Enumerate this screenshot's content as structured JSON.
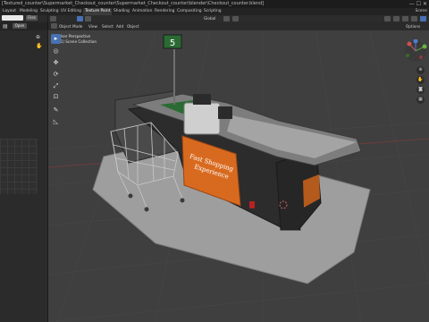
{
  "window": {
    "title": "[Textured_counter\\Supermarket_Checkout_counter\\Supermarket_Checkout_counter\\blender\\Checkout_counter.blend]",
    "scene_label": "Scene"
  },
  "workspace_tabs": [
    {
      "label": "Layout",
      "active": false
    },
    {
      "label": "Modeling",
      "active": false
    },
    {
      "label": "Sculpting",
      "active": false
    },
    {
      "label": "UV Editing",
      "active": false
    },
    {
      "label": "Texture Paint",
      "active": true
    },
    {
      "label": "Shading",
      "active": false
    },
    {
      "label": "Animation",
      "active": false
    },
    {
      "label": "Rendering",
      "active": false
    },
    {
      "label": "Compositing",
      "active": false
    },
    {
      "label": "Scripting",
      "active": false
    }
  ],
  "left_panel": {
    "files_label": "Files",
    "open_label": "Open"
  },
  "viewport_header": {
    "global_label": "Global",
    "mode_label": "Object Mode",
    "menus": [
      "View",
      "Select",
      "Add",
      "Object"
    ],
    "options_label": "Options"
  },
  "viewport_info": {
    "line1": "User Perspective",
    "line2": "(1) Scene Collection"
  },
  "scene": {
    "sign_text_line1": "Fast Shopping",
    "sign_text_line2": "Experience",
    "lane_number": "5",
    "colors": {
      "floor_mat": "#9e9e9e",
      "counter_body": "#2a2a2a",
      "counter_top": "#8a8a8a",
      "sign_orange": "#d86a1f",
      "lane_green": "#2a6b34"
    }
  },
  "icons": {
    "tools": [
      "cursor-select-icon",
      "cursor-3d-icon",
      "move-icon",
      "rotate-icon",
      "scale-icon",
      "transform-icon",
      "annotate-icon",
      "measure-icon"
    ],
    "nav": [
      "zoom-icon",
      "hand-pan-icon",
      "camera-icon",
      "grid-icon"
    ]
  }
}
